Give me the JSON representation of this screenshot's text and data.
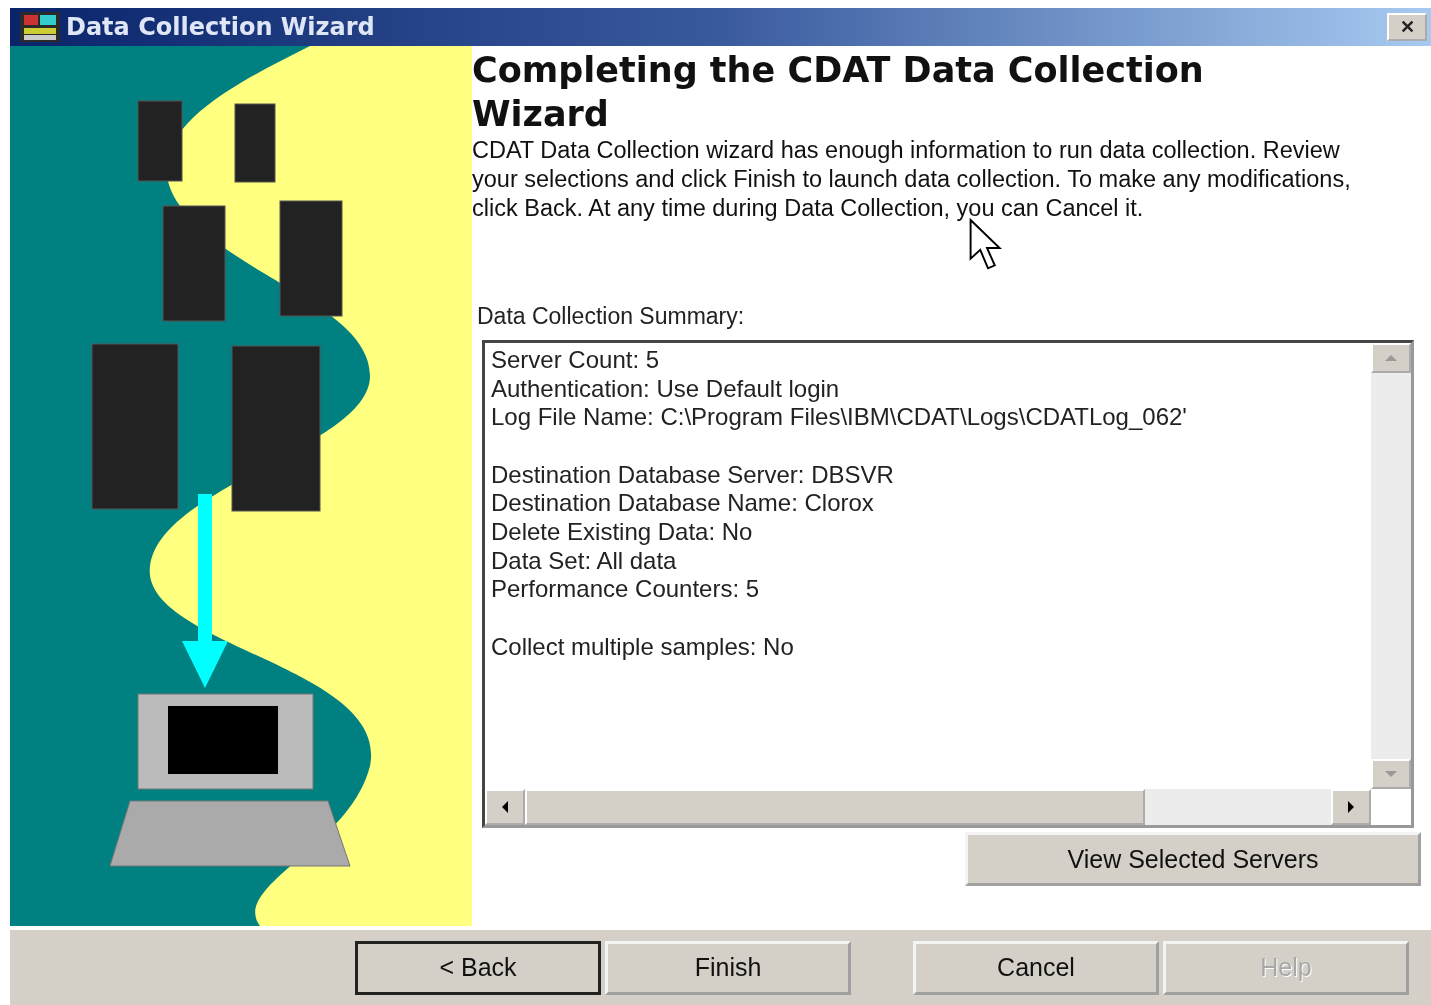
{
  "window": {
    "title": "Data Collection Wizard",
    "close_label": "✕"
  },
  "heading": "Completing the CDAT Data Collection Wizard",
  "description": "CDAT Data Collection wizard has enough information to run data collection. Review your selections and click Finish to launch data collection. To make any modifications, click Back. At any time during Data Collection, you can Cancel it.",
  "summary": {
    "label": "Data Collection Summary:",
    "groups": [
      [
        "Server Count: 5",
        "Authentication: Use Default login",
        "Log File Name: C:\\Program Files\\IBM\\CDAT\\Logs\\CDATLog_062'"
      ],
      [
        "Destination Database Server: DBSVR",
        "Destination Database Name: Clorox",
        "Delete Existing Data: No",
        "Data Set: All data",
        "Performance Counters: 5"
      ],
      [
        "Collect multiple samples: No"
      ]
    ]
  },
  "view_button": {
    "label": "View Selected Servers",
    "disabled": false
  },
  "buttons": [
    {
      "label": "< Back",
      "default": true,
      "disabled": false
    },
    {
      "label": "Finish",
      "default": false,
      "disabled": false
    },
    {
      "label": "Cancel",
      "default": false,
      "disabled": false
    },
    {
      "label": "Help",
      "default": false,
      "disabled": true
    }
  ]
}
